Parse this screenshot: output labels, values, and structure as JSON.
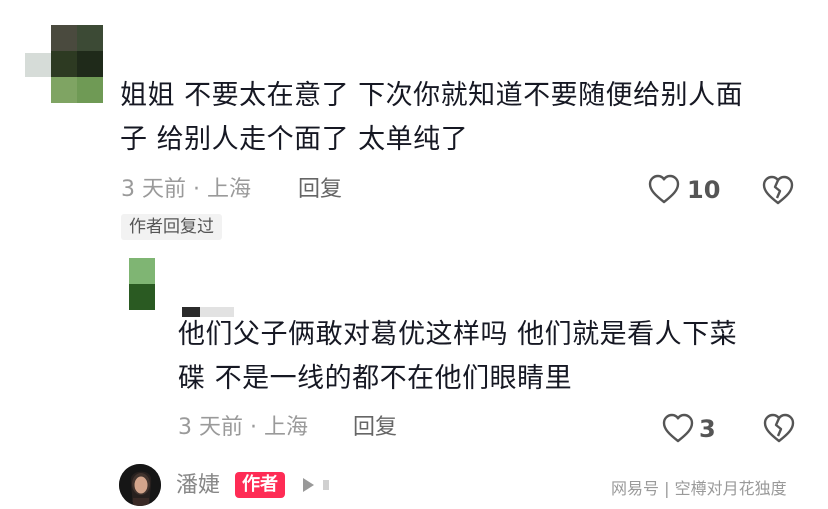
{
  "comment": {
    "text_line1": "姐姐 不要太在意了 下次你就知道不要随便给别人面",
    "text_line2": "子 给别人走个面了 太单纯了",
    "meta": "3 天前 · 上海",
    "reply_label": "回复",
    "like_count": "10",
    "author_replied_tag": "作者回复过",
    "like_icon": "heart-outline",
    "dislike_icon": "broken-heart-outline"
  },
  "reply": {
    "text_line1": "他们父子俩敢对葛优这样吗 他们就是看人下菜",
    "text_line2": "碟 不是一线的都不在他们眼睛里",
    "meta": "3 天前 · 上海",
    "reply_label": "回复",
    "like_count": "3",
    "like_icon": "heart-outline",
    "dislike_icon": "broken-heart-outline"
  },
  "author_row": {
    "name": "潘婕",
    "badge": "作者",
    "play_icon": "play-triangle"
  },
  "watermark": {
    "text": "网易号 | 空樽对月花独度"
  },
  "colors": {
    "badge": "#fe2c55",
    "text": "#161823",
    "meta": "#9a9a9a"
  }
}
